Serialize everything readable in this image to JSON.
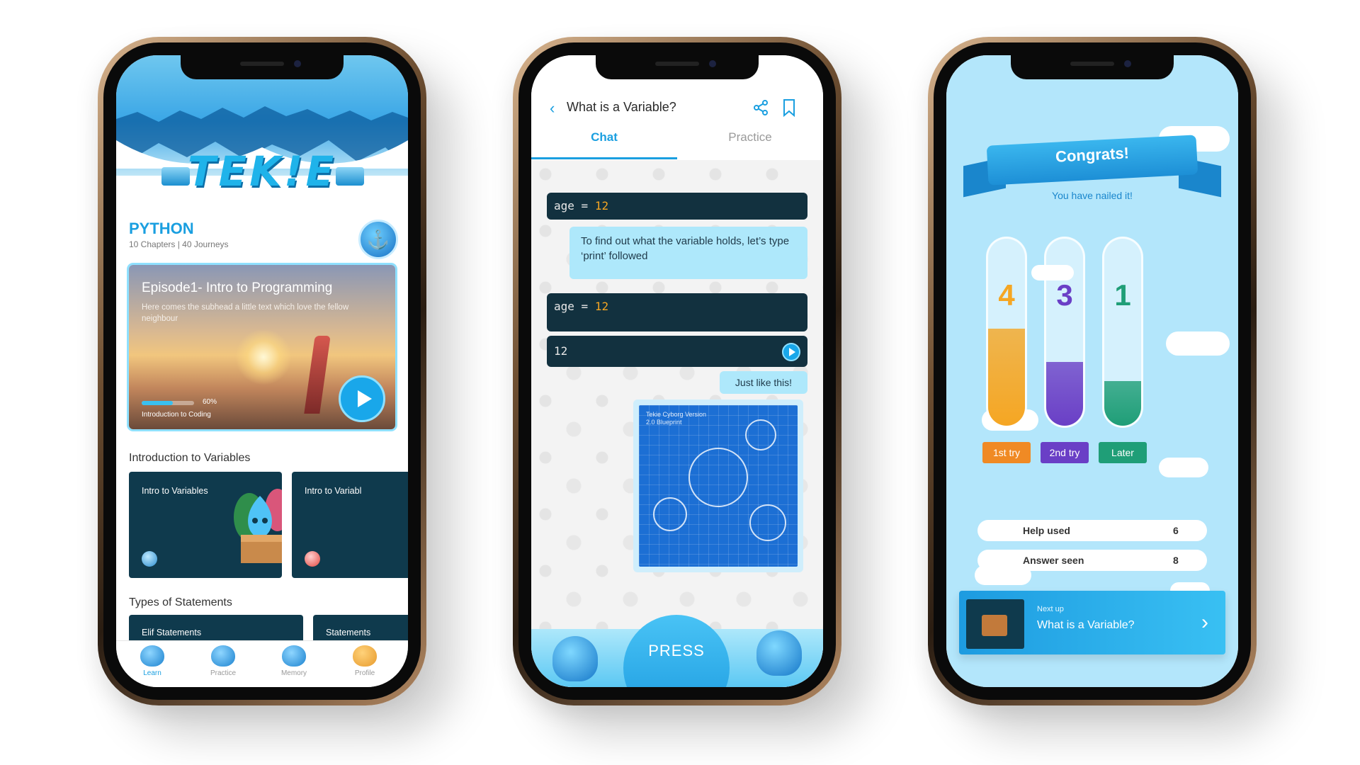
{
  "phone1": {
    "logo_text": "TEK!E",
    "course": {
      "title": "PYTHON",
      "subtitle": "10 Chapters | 40 Journeys"
    },
    "hero": {
      "title": "Episode1- Intro to Programming",
      "subtitle": "Here comes the subhead a little text which love the fellow neighbour",
      "progress_percent": 60,
      "progress_text": "60%",
      "progress_label": "Introduction to Coding"
    },
    "section1": {
      "title": "Introduction to Variables",
      "cards": [
        {
          "label": "Intro to Variables"
        },
        {
          "label": "Intro to Variabl"
        }
      ]
    },
    "section2": {
      "title": "Types of Statements",
      "cards": [
        {
          "label": "Elif Statements"
        },
        {
          "label": "Statements"
        }
      ]
    },
    "tabbar": [
      {
        "label": "Learn",
        "icon": "learn-icon"
      },
      {
        "label": "Practice",
        "icon": "practice-icon"
      },
      {
        "label": "Memory",
        "icon": "memory-icon"
      },
      {
        "label": "Profile",
        "icon": "profile-icon"
      }
    ]
  },
  "phone2": {
    "title": "What is a Variable?",
    "tabs": [
      {
        "label": "Chat"
      },
      {
        "label": "Practice"
      }
    ],
    "code1": {
      "var": "age",
      "op": "=",
      "num": "12"
    },
    "message1": "To find out what the variable holds, let’s type ‘print’ followed",
    "code2": {
      "var": "age",
      "op": "=",
      "num": "12"
    },
    "output": "12",
    "message2": "Just like this!",
    "blueprint_caption": "Tekie Cyborg Version 2.0 Blueprint",
    "press_label": "PRESS"
  },
  "phone3": {
    "banner": "Congrats!",
    "subtitle": "You have nailed it!",
    "tubes": [
      {
        "value": "4",
        "label": "1st try",
        "fill_fraction": 0.52,
        "color": "#f5a623"
      },
      {
        "value": "3",
        "label": "2nd try",
        "fill_fraction": 0.34,
        "color": "#6a3fc6"
      },
      {
        "value": "1",
        "label": "Later",
        "fill_fraction": 0.24,
        "color": "#1f9e77"
      }
    ],
    "stats": [
      {
        "label": "Help used",
        "value": "6"
      },
      {
        "label": "Answer seen",
        "value": "8"
      }
    ],
    "next": {
      "eyebrow": "Next up",
      "title": "What is a Variable?"
    }
  }
}
